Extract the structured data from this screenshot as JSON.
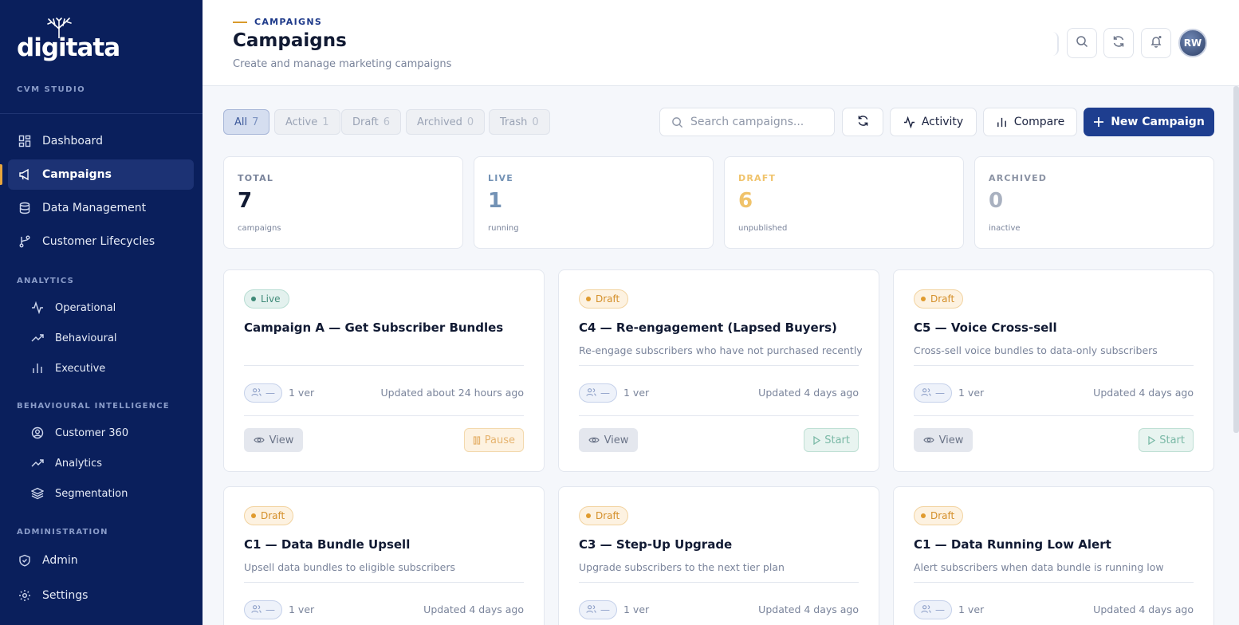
{
  "brand": {
    "logo_text": "digitata",
    "studio": "CVM STUDIO"
  },
  "sidebar": {
    "main": [
      {
        "label": "Dashboard",
        "icon": "grid-icon"
      },
      {
        "label": "Campaigns",
        "icon": "megaphone-icon",
        "active": true
      },
      {
        "label": "Data Management",
        "icon": "database-icon"
      },
      {
        "label": "Customer Lifecycles",
        "icon": "branch-icon"
      }
    ],
    "analytics_title": "ANALYTICS",
    "analytics": [
      {
        "label": "Operational",
        "icon": "activity-icon"
      },
      {
        "label": "Behavioural",
        "icon": "trending-up-icon"
      },
      {
        "label": "Executive",
        "icon": "bar-chart-icon"
      }
    ],
    "bi_title": "BEHAVIOURAL INTELLIGENCE",
    "bi": [
      {
        "label": "Customer 360",
        "icon": "user-circle-icon"
      },
      {
        "label": "Analytics",
        "icon": "trending-up-icon"
      },
      {
        "label": "Segmentation",
        "icon": "layers-icon"
      }
    ],
    "admin_title": "ADMINISTRATION",
    "admin": [
      {
        "label": "Admin",
        "icon": "shield-icon"
      },
      {
        "label": "Settings",
        "icon": "gear-icon"
      }
    ]
  },
  "header": {
    "breadcrumb": "CAMPAIGNS",
    "title": "Campaigns",
    "subtitle": "Create and manage marketing campaigns",
    "avatar": "RW"
  },
  "filters": [
    {
      "label": "All",
      "count": "7",
      "selected": true
    },
    {
      "label": "Active",
      "count": "1"
    },
    {
      "label": "Draft",
      "count": "6"
    },
    {
      "label": "Archived",
      "count": "0"
    },
    {
      "label": "Trash",
      "count": "0"
    }
  ],
  "toolbar": {
    "search_placeholder": "Search campaigns...",
    "activity": "Activity",
    "compare": "Compare",
    "new_campaign": "New Campaign"
  },
  "stats": [
    {
      "label": "TOTAL",
      "value": "7",
      "sub": "campaigns",
      "color": "#111a33",
      "label_color": "#7a849b"
    },
    {
      "label": "LIVE",
      "value": "1",
      "sub": "running",
      "color": "#7392b5",
      "label_color": "#7392b5"
    },
    {
      "label": "DRAFT",
      "value": "6",
      "sub": "unpublished",
      "color": "#f0c36b",
      "label_color": "#f0c36b"
    },
    {
      "label": "ARCHIVED",
      "value": "0",
      "sub": "inactive",
      "color": "#a9b1c0",
      "label_color": "#8b93a4"
    }
  ],
  "campaigns": [
    {
      "status": "Live",
      "title": "Campaign A — Get Subscriber Bundles",
      "desc": "",
      "users": "—",
      "ver": "1 ver",
      "updated": "Updated about 24 hours ago",
      "view": "View",
      "action": "Pause"
    },
    {
      "status": "Draft",
      "title": "C4 — Re-engagement (Lapsed Buyers)",
      "desc": "Re-engage subscribers who have not purchased recently",
      "users": "—",
      "ver": "1 ver",
      "updated": "Updated 4 days ago",
      "view": "View",
      "action": "Start"
    },
    {
      "status": "Draft",
      "title": "C5 — Voice Cross-sell",
      "desc": "Cross-sell voice bundles to data-only subscribers",
      "users": "—",
      "ver": "1 ver",
      "updated": "Updated 4 days ago",
      "view": "View",
      "action": "Start"
    },
    {
      "status": "Draft",
      "title": "C1 — Data Bundle Upsell",
      "desc": "Upsell data bundles to eligible subscribers",
      "users": "—",
      "ver": "1 ver",
      "updated": "Updated 4 days ago"
    },
    {
      "status": "Draft",
      "title": "C3 — Step-Up Upgrade",
      "desc": "Upgrade subscribers to the next tier plan",
      "users": "—",
      "ver": "1 ver",
      "updated": "Updated 4 days ago"
    },
    {
      "status": "Draft",
      "title": "C1 — Data Running Low Alert",
      "desc": "Alert subscribers when data bundle is running low",
      "users": "—",
      "ver": "1 ver",
      "updated": "Updated 4 days ago"
    }
  ]
}
